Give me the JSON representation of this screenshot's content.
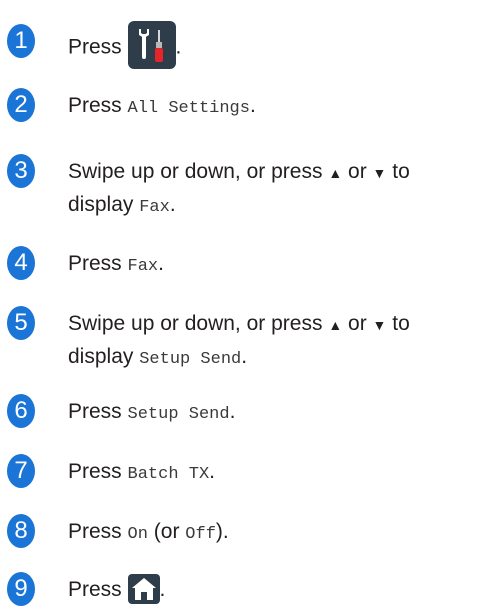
{
  "steps": [
    {
      "num": "1",
      "press": "Press",
      "after": "."
    },
    {
      "num": "2",
      "press": "Press",
      "code": "All Settings",
      "after": "."
    },
    {
      "num": "3",
      "pre": "Swipe up or down, or press",
      "up": "▲",
      "or": "or",
      "down": "▼",
      "to": "to",
      "display": "display",
      "code": "Fax",
      "after": "."
    },
    {
      "num": "4",
      "press": "Press",
      "code": "Fax",
      "after": "."
    },
    {
      "num": "5",
      "pre": "Swipe up or down, or press",
      "up": "▲",
      "or": "or",
      "down": "▼",
      "to": "to",
      "display": "display",
      "code": "Setup Send",
      "after": "."
    },
    {
      "num": "6",
      "press": "Press",
      "code": "Setup Send",
      "after": "."
    },
    {
      "num": "7",
      "press": "Press",
      "code": "Batch TX",
      "after": "."
    },
    {
      "num": "8",
      "press": "Press",
      "code": "On",
      "paren_open": "(or",
      "code2": "Off",
      "paren_close": ").",
      "after": ""
    },
    {
      "num": "9",
      "press": "Press",
      "after": "."
    }
  ],
  "icons": {
    "settings_icon": "settings-tools-icon",
    "home_icon": "home-icon"
  },
  "colors": {
    "badge": "#1a75d6",
    "icon_bg": "#2f3d4a",
    "screwdriver_handle": "#e5242b"
  }
}
